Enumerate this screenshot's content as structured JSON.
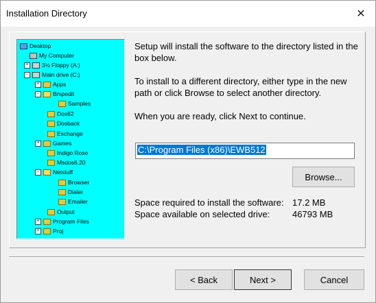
{
  "window": {
    "title": "Installation Directory",
    "close_glyph": "✕"
  },
  "tree": {
    "items": [
      {
        "label": "Desktop",
        "icon": "desktop-icon"
      },
      {
        "label": "My Computer",
        "icon": "computer-icon"
      },
      {
        "label": "3½ Floppy (A:)",
        "icon": "floppy-drive-icon"
      },
      {
        "label": "Main drive (C:)",
        "icon": "hard-drive-icon"
      },
      {
        "label": "Apps",
        "icon": "folder-icon"
      },
      {
        "label": "Bmpedit",
        "icon": "folder-icon"
      },
      {
        "label": "Samples",
        "icon": "folder-icon"
      },
      {
        "label": "Dos62",
        "icon": "folder-icon"
      },
      {
        "label": "Dosback",
        "icon": "folder-icon"
      },
      {
        "label": "Exchange",
        "icon": "folder-icon"
      },
      {
        "label": "Games",
        "icon": "folder-icon"
      },
      {
        "label": "Indigo Rose",
        "icon": "folder-icon"
      },
      {
        "label": "Msdos6.20",
        "icon": "folder-icon"
      },
      {
        "label": "Netstuff",
        "icon": "folder-icon"
      },
      {
        "label": "Browser",
        "icon": "folder-icon"
      },
      {
        "label": "Dialer",
        "icon": "folder-icon"
      },
      {
        "label": "Emailer",
        "icon": "folder-icon"
      },
      {
        "label": "Output",
        "icon": "folder-icon"
      },
      {
        "label": "Program Files",
        "icon": "folder-icon"
      },
      {
        "label": "Proj",
        "icon": "folder-icon"
      }
    ]
  },
  "description": {
    "line1": "Setup will install the software to the directory listed in the box below.",
    "line2": "To install to a different directory, either type in the new path or click Browse to select another directory.",
    "line3": "When you are ready, click Next to continue."
  },
  "path": {
    "value": "C:\\Program Files (x86)\\EWB512"
  },
  "buttons": {
    "browse": "Browse...",
    "back": "< Back",
    "next": "Next >",
    "cancel": "Cancel"
  },
  "space": {
    "required_label": "Space required to install the software:",
    "required_value": "17.2 MB",
    "available_label": "Space available on selected drive:",
    "available_value": "46793 MB"
  },
  "colors": {
    "tree_background": "#00ffff",
    "selection": "#0078d7"
  }
}
